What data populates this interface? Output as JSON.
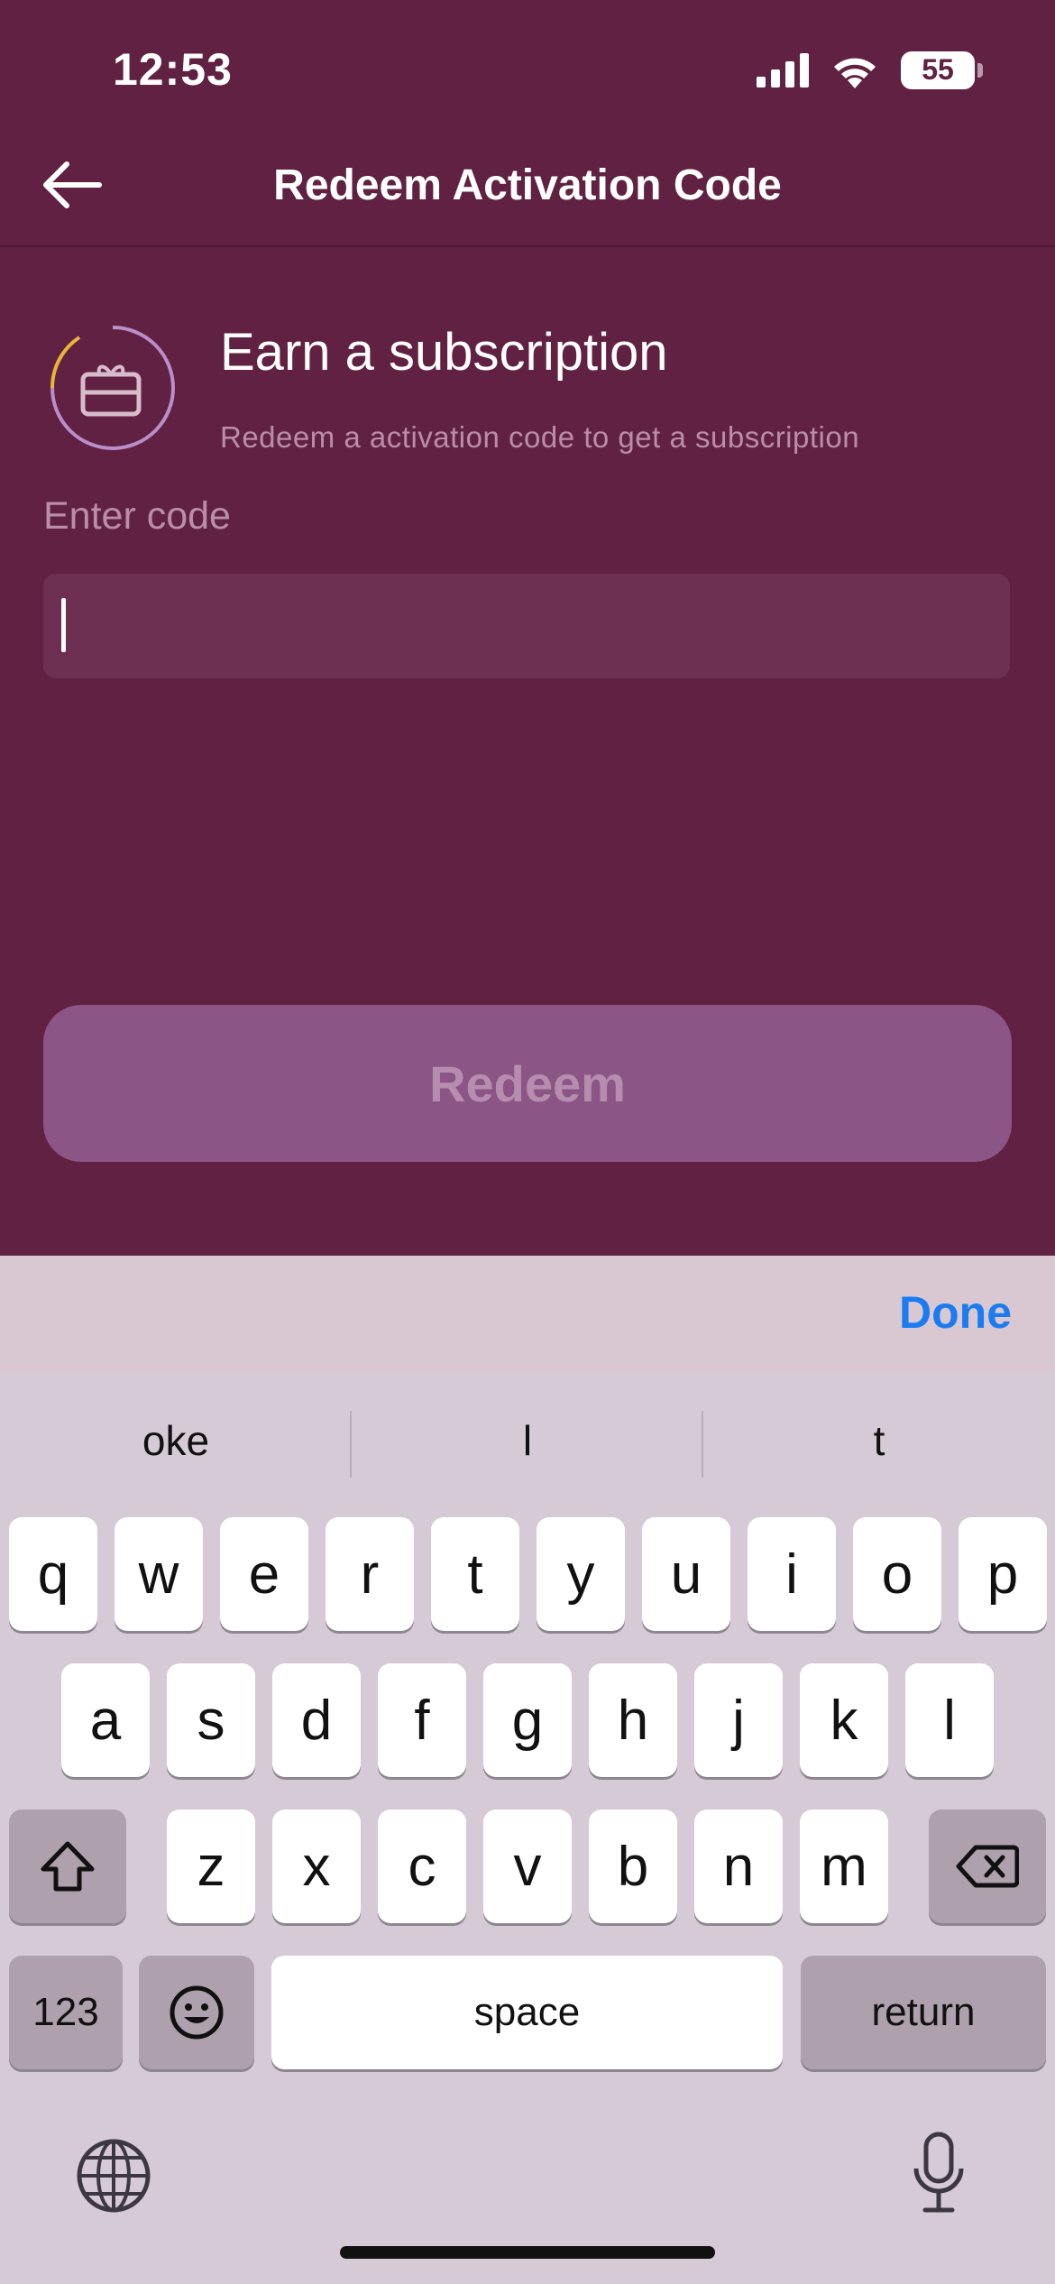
{
  "status_bar": {
    "time": "12:53",
    "battery": "55",
    "icons": [
      "signal-icon",
      "wifi-icon",
      "battery-icon"
    ]
  },
  "nav": {
    "title": "Redeem Activation Code",
    "back_icon": "arrow-left-icon"
  },
  "header": {
    "title": "Earn a subscription",
    "subtitle": "Redeem a activation code to get a subscription",
    "icon": "gift-card-icon"
  },
  "form": {
    "label": "Enter code",
    "value": "",
    "placeholder": ""
  },
  "actions": {
    "redeem_label": "Redeem"
  },
  "keyboard": {
    "done_label": "Done",
    "suggestions": [
      "oke",
      "l",
      "t"
    ],
    "row1": [
      "q",
      "w",
      "e",
      "r",
      "t",
      "y",
      "u",
      "i",
      "o",
      "p"
    ],
    "row2": [
      "a",
      "s",
      "d",
      "f",
      "g",
      "h",
      "j",
      "k",
      "l"
    ],
    "row3": [
      "z",
      "x",
      "c",
      "v",
      "b",
      "n",
      "m"
    ],
    "numbers_label": "123",
    "space_label": "space",
    "return_label": "return"
  },
  "colors": {
    "background": "#612143",
    "input_bg": "#6d3052",
    "button_bg": "#8b5585",
    "accent_blue": "#1a7cf0",
    "keyboard_bg": "#d5cad6"
  }
}
